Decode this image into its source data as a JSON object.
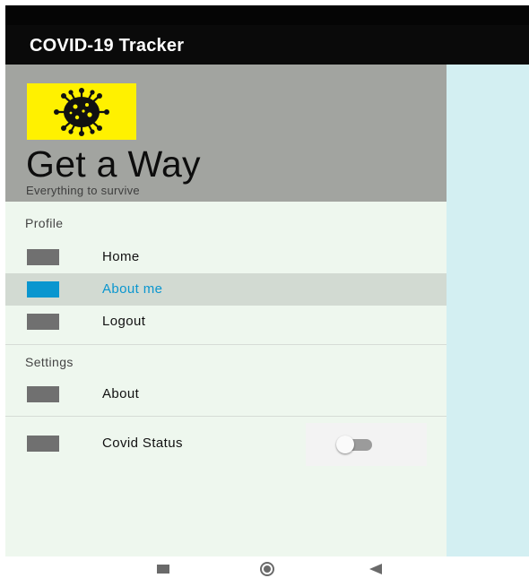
{
  "app": {
    "title": "COVID-19 Tracker"
  },
  "drawer": {
    "header": {
      "title": "Get a Way",
      "subtitle": "Everything to survive",
      "logo_icon": "coronavirus-icon",
      "logo_background": "#fff100"
    },
    "sections": [
      {
        "label": "Profile",
        "items": [
          {
            "label": "Home",
            "active": false
          },
          {
            "label": "About me",
            "active": true
          },
          {
            "label": "Logout",
            "active": false
          }
        ]
      },
      {
        "label": "Settings",
        "items": [
          {
            "label": "About",
            "active": false
          }
        ]
      }
    ],
    "covid_status": {
      "label": "Covid Status",
      "toggle_on": false
    }
  },
  "colors": {
    "accent": "#0a96cf",
    "header_bg": "#a2a4a0",
    "drawer_bg": "#eef7ee",
    "content_bg": "#d3eff2"
  },
  "nav_bar": {
    "icons": [
      "recents-icon",
      "home-icon",
      "back-icon"
    ]
  }
}
